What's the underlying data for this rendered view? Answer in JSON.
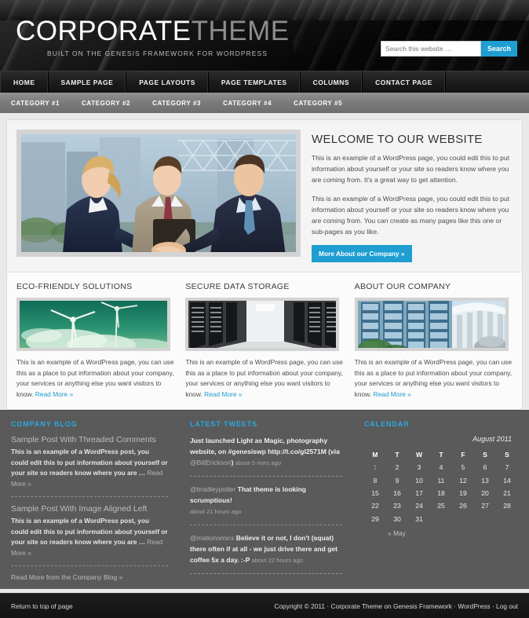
{
  "header": {
    "logo_part1": "CORPORATE",
    "logo_part2": "THEME",
    "tagline": "BUILT ON THE GENESIS FRAMEWORK FOR WORDPRESS",
    "search_placeholder": "Search this website …",
    "search_value": "",
    "search_button": "Search",
    "accent_color": "#1e9ed1"
  },
  "nav_primary": [
    {
      "label": "HOME"
    },
    {
      "label": "SAMPLE PAGE"
    },
    {
      "label": "PAGE LAYOUTS"
    },
    {
      "label": "PAGE TEMPLATES"
    },
    {
      "label": "COLUMNS"
    },
    {
      "label": "CONTACT PAGE"
    }
  ],
  "nav_secondary": [
    {
      "label": "CATEGORY #1"
    },
    {
      "label": "CATEGORY #2"
    },
    {
      "label": "CATEGORY #3"
    },
    {
      "label": "CATEGORY #4"
    },
    {
      "label": "CATEGORY #5"
    }
  ],
  "hero": {
    "image_alt": "business-handshake-photo",
    "title": "WELCOME TO OUR WEBSITE",
    "paragraph1": "This is an example of a WordPress page, you could edit this to put information about yourself or your site so readers know where you are coming from. It's a great way to get attention.",
    "paragraph2": "This is an example of a WordPress page, you could edit this to put information about yourself or your site so readers know where you are coming from. You can create as many pages like this one or sub-pages as you like.",
    "button_label": "More About our Company »"
  },
  "features": [
    {
      "title": "ECO-FRIENDLY SOLUTIONS",
      "image_alt": "wind-turbines-photo",
      "body": "This is an example of a WordPress page, you can use this as a place to put information about your company, your services or anything else you want visitors to know.",
      "read_more": "Read More »"
    },
    {
      "title": "SECURE DATA STORAGE",
      "image_alt": "server-room-photo",
      "body": "This is an example of a WordPress page, you can use this as a place to put information about your company, your services or anything else you want visitors to know.",
      "read_more": "Read More »"
    },
    {
      "title": "ABOUT OUR COMPANY",
      "image_alt": "office-building-photo",
      "body": "This is an example of a WordPress page, you can use this as a place to put information about your company, your services or anything else you want visitors to know.",
      "read_more": "Read More »"
    }
  ],
  "blog_widget": {
    "title": "COMPANY BLOG",
    "posts": [
      {
        "title": "Sample Post With Threaded Comments",
        "excerpt": "This is an example of a WordPress post, you could edit this to put information about yourself or your site so readers know where you are …",
        "read_more": "Read More »"
      },
      {
        "title": "Sample Post With Image Aligned Left",
        "excerpt": "This is an example of a WordPress post, you could edit this to put information about yourself or your site so readers know where you are …",
        "read_more": "Read More »"
      }
    ],
    "more_link": "Read More from the Company Blog »"
  },
  "tweets_widget": {
    "title": "LATEST TWEETS",
    "tweets": [
      {
        "text": "Just launched Light as Magic, photography website, on #genesiswp http://t.co/gI2571M (via ",
        "handle": "@BillErickson",
        "suffix": ")",
        "time": "about 5 mins ago"
      },
      {
        "handle": "@bradleypotter",
        "text": "That theme is looking scrumptious!",
        "time": "about 21 hours ago"
      },
      {
        "handle": "@mationomics",
        "text": "Believe it or not, I don't (squat) there often if at all - we just drive there and get coffee 5x a day. :-P",
        "time": "about 22 hours ago"
      }
    ]
  },
  "calendar_widget": {
    "title": "CALENDAR",
    "month_label": "August 2011",
    "weekdays": [
      "M",
      "T",
      "W",
      "T",
      "F",
      "S",
      "S"
    ],
    "weeks": [
      [
        "1",
        "2",
        "3",
        "4",
        "5",
        "6",
        "7"
      ],
      [
        "8",
        "9",
        "10",
        "11",
        "12",
        "13",
        "14"
      ],
      [
        "15",
        "16",
        "17",
        "18",
        "19",
        "20",
        "21"
      ],
      [
        "22",
        "23",
        "24",
        "25",
        "26",
        "27",
        "28"
      ],
      [
        "29",
        "30",
        "31",
        "",
        "",
        "",
        ""
      ]
    ],
    "prev_link": "« May"
  },
  "footer": {
    "return_link": "Return to top of page",
    "copyright": "Copyright © 2011 · Corporate Theme on Genesis Framework · WordPress · Log out"
  }
}
